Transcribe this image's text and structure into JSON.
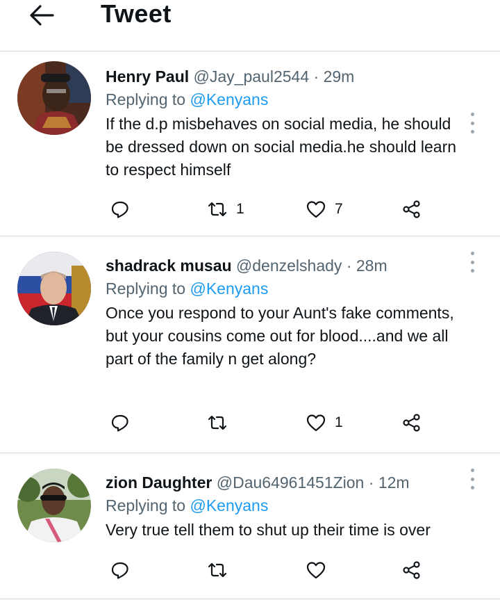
{
  "header": {
    "title": "Tweet",
    "back_icon": "arrow-left-icon"
  },
  "tweets": [
    {
      "name": "Henry Paul",
      "handle": "@Jay_paul2544",
      "separator": "·",
      "time": "29m",
      "replying_label": "Replying to",
      "replying_to": "@Kenyans",
      "text": "If the d.p misbehaves on social media, he should be dressed down on social media.he should learn to respect himself",
      "retweets": "1",
      "likes": "7"
    },
    {
      "name": "shadrack musau",
      "handle": "@denzelshady",
      "separator": "·",
      "time": "28m",
      "replying_label": "Replying to",
      "replying_to": "@Kenyans",
      "text": "Once you respond to your Aunt's fake comments, but your cousins come out for blood....and we all part of the family n get along?",
      "retweets": "",
      "likes": "1"
    },
    {
      "name": "zion Daughter",
      "handle": "@Dau64961451Zion",
      "separator": "·",
      "time": "12m",
      "replying_label": "Replying to",
      "replying_to": "@Kenyans",
      "text": "Very true tell them to shut up their time is over",
      "retweets": "",
      "likes": ""
    }
  ],
  "icons": {
    "reply": "reply-bubble-icon",
    "retweet": "retweet-icon",
    "like": "heart-icon",
    "share": "share-icon",
    "more": "more-vertical-icon"
  },
  "colors": {
    "accent": "#1d9bf0",
    "secondary_text": "#536471",
    "divider": "#cfd9de"
  }
}
